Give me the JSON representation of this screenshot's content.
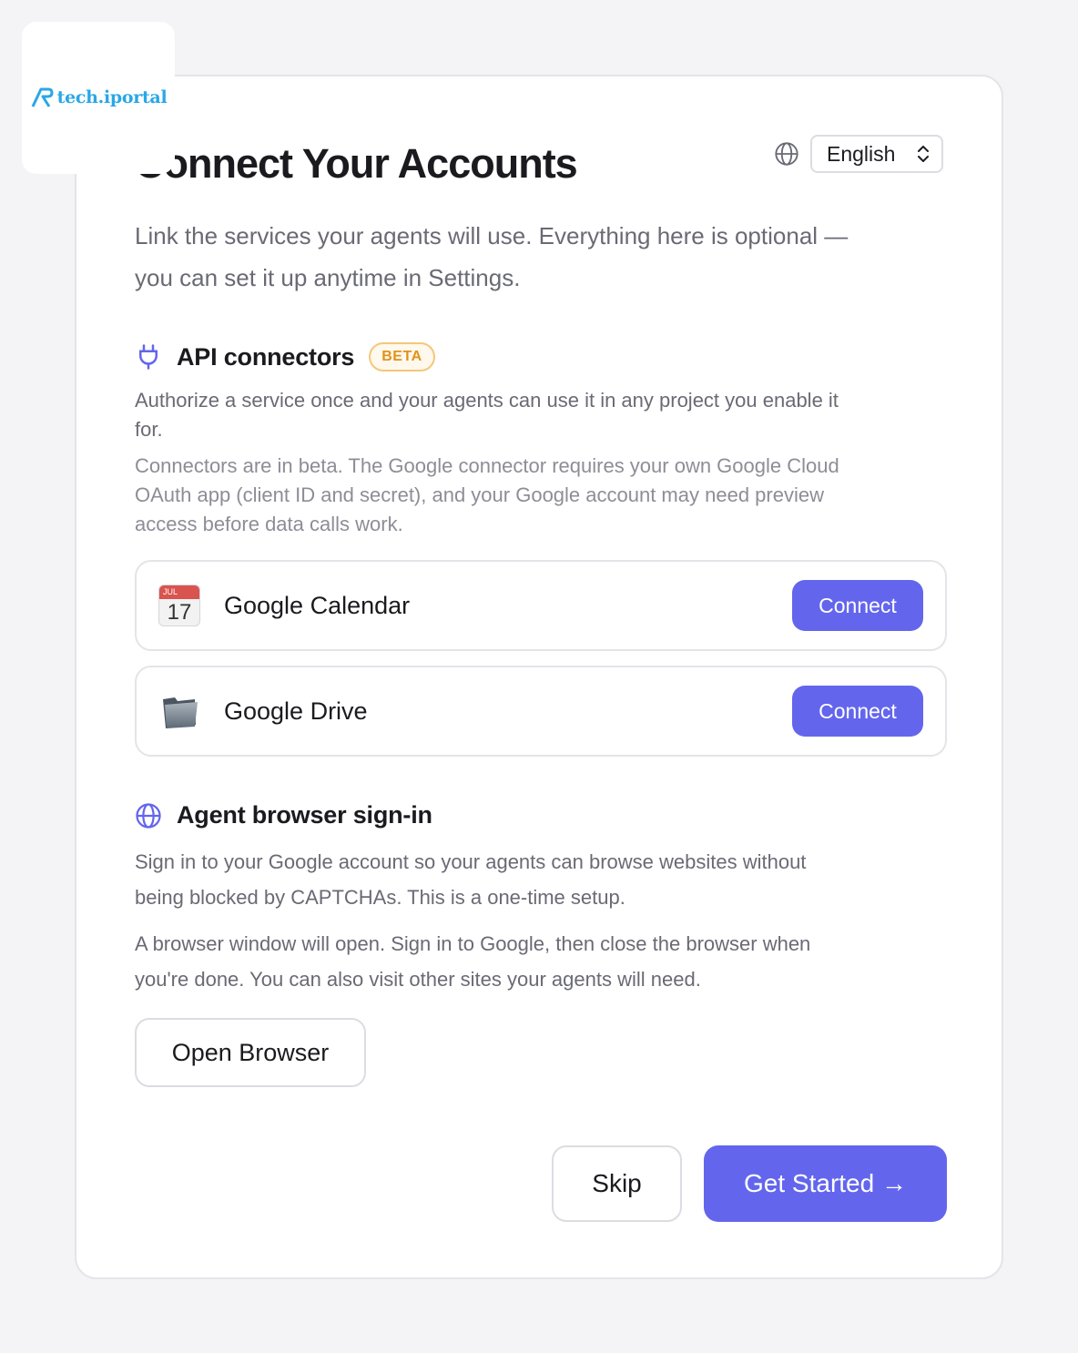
{
  "logo": {
    "text": "tech.iportal"
  },
  "header": {
    "title": "Connect Your Accounts",
    "language": "English"
  },
  "intro": {
    "line1": "Link the services your agents will use. Everything here is optional —",
    "line2": "you can set it up anytime in Settings."
  },
  "api_section": {
    "title": "API connectors",
    "badge": "BETA",
    "description_line1": "Authorize a service once and your agents can use it in any project you enable it",
    "description_line2": "for.",
    "note_line1": "Connectors are in beta. The Google connector requires your own Google Cloud",
    "note_line2": "OAuth app (client ID and secret), and your Google account may need preview",
    "note_line3": "access before data calls work.",
    "connectors": [
      {
        "name": "Google Calendar",
        "icon": "calendar-icon",
        "cal_month": "JUL",
        "cal_day": "17",
        "button": "Connect"
      },
      {
        "name": "Google Drive",
        "icon": "folder-icon",
        "button": "Connect"
      }
    ]
  },
  "browser_section": {
    "title": "Agent browser sign-in",
    "desc1_line1": "Sign in to your Google account so your agents can browse websites without",
    "desc1_line2": "being blocked by CAPTCHAs. This is a one-time setup.",
    "desc2_line1": "A browser window will open. Sign in to Google, then close the browser when",
    "desc2_line2": "you're done. You can also visit other sites your agents will need.",
    "button": "Open Browser"
  },
  "footer": {
    "skip": "Skip",
    "get_started": "Get Started →"
  },
  "colors": {
    "accent": "#6366ec",
    "badge_text": "#e0921a",
    "logo": "#2aa7e6"
  }
}
